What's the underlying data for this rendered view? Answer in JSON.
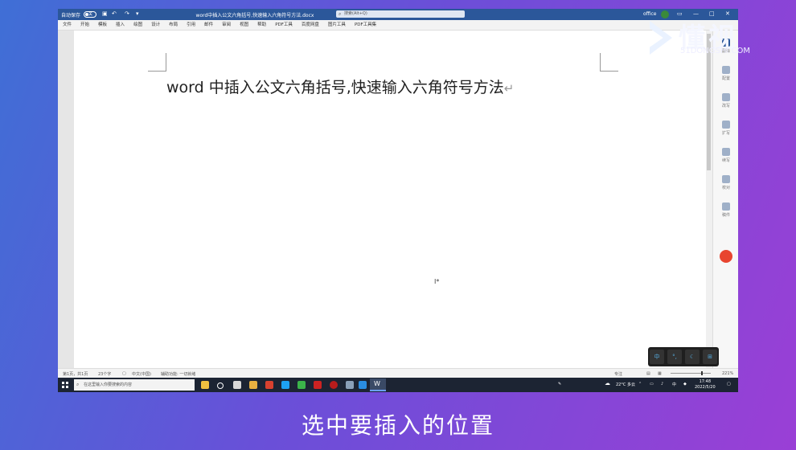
{
  "titlebar": {
    "autosave": "自动保存",
    "toggle_label": "关",
    "doc_title": "word中插入公文六角括号,快速输入六角符号方法.docx",
    "search_placeholder": "搜索(Alt+Q)",
    "office_label": "office",
    "minimize": "—",
    "maximize": "□",
    "close": "✕"
  },
  "ribbon": {
    "tabs": [
      "文件",
      "开始",
      "模板",
      "插入",
      "绘图",
      "设计",
      "布局",
      "引用",
      "邮件",
      "审阅",
      "视图",
      "帮助",
      "PDF工具",
      "百度网盘",
      "图片工具",
      "PDF工具集"
    ]
  },
  "document": {
    "heading": "word 中插入公文六角括号,快速输入六角符号方法",
    "paragraph_mark": "↵",
    "cursor": "I*"
  },
  "side_pane": {
    "items": [
      "翻译",
      "配置",
      "改写",
      "扩写",
      "续写",
      "校对",
      "稿件"
    ]
  },
  "ime": {
    "buttons": [
      "中",
      "°,",
      "☾",
      "⊞"
    ]
  },
  "status_bar": {
    "page": "第1页，共1页",
    "words": "23个字",
    "lang": "中文(中国)",
    "assist": "辅助功能: 一切就绪",
    "focus": "专注",
    "zoom": "221%"
  },
  "taskbar": {
    "search_placeholder": "在这里输入你要搜索的内容",
    "weather": "22°C 多云",
    "ime": "中",
    "time": "17:48",
    "date": "2022/5/20"
  },
  "watermark": {
    "brand": "懂视",
    "site": "51DONGSHI.COM"
  },
  "caption": "选中要插入的位置",
  "colors": {
    "titlebar": "#2b579a",
    "taskbar": "#1c2433",
    "background_start": "#3f6fd6",
    "background_end": "#9a3fd6"
  }
}
